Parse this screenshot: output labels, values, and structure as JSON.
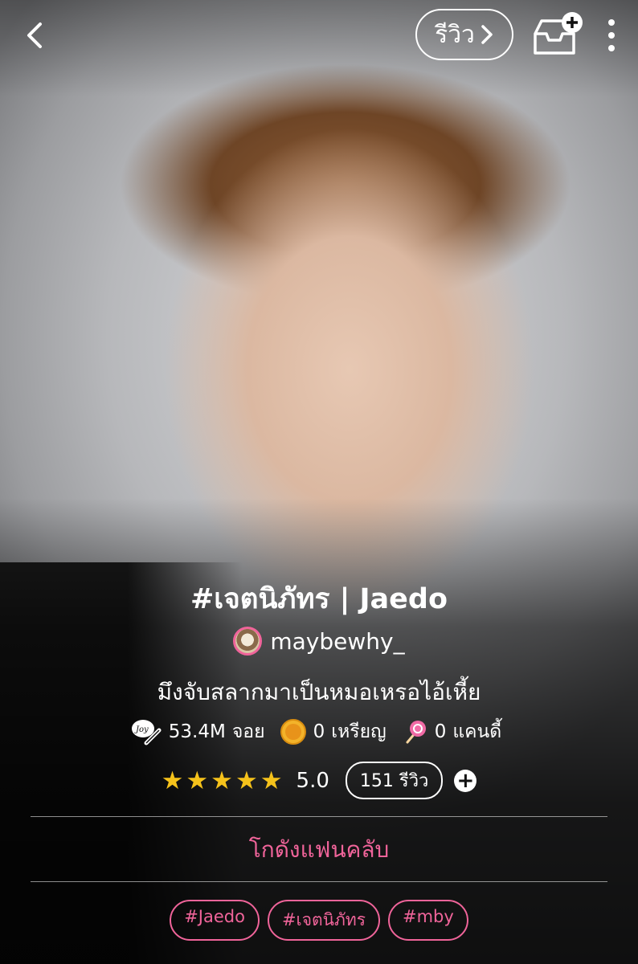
{
  "header": {
    "back_icon": "chevron-left-icon",
    "review_label": "รีวิว",
    "inbox_icon": "inbox-add-icon",
    "more_icon": "more-vertical-icon"
  },
  "story": {
    "title": "#เจตนิภัทร | Jaedo",
    "author": "maybewhy_",
    "description": "มึงจับสลากมาเป็นหมอเหรอไอ้เหี้ย"
  },
  "stats": {
    "reads_value": "53.4M",
    "reads_unit": "จอย",
    "coins_value": "0",
    "coins_unit": "เหรียญ",
    "candy_value": "0",
    "candy_unit": "แคนดี้"
  },
  "rating": {
    "stars_filled": 5,
    "stars_display": "★★★★★",
    "score": "5.0",
    "review_count": "151 รีวิว"
  },
  "fanclub_label": "โกดังแฟนคลับ",
  "tags": [
    "#Jaedo",
    "#เจตนิภัทร",
    "#mby"
  ],
  "colors": {
    "accent": "#f0649a",
    "star": "#f5c21b"
  }
}
